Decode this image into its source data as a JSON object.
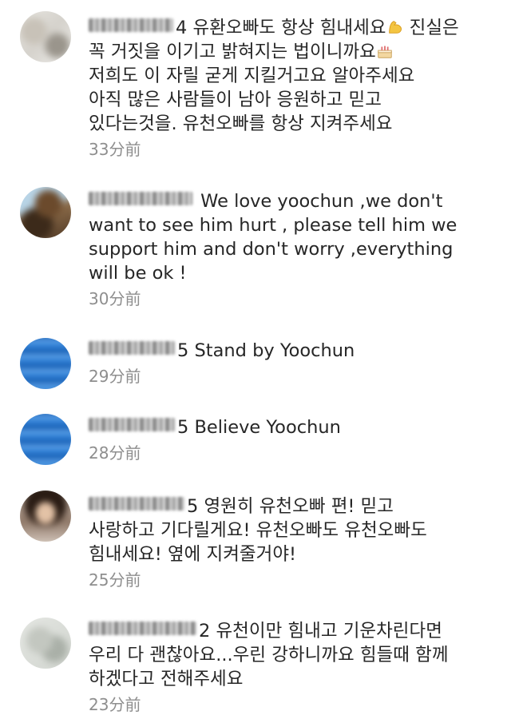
{
  "comments": [
    {
      "user_tail": "4",
      "lines": [
        "유환오빠도 항상 힘내세요",
        "진실은",
        "꼭 거짓을 이기고 밝혀지는 법이니까요",
        "저희도 이 자릴 굳게 지킬거고요 알아주세요",
        "아직 많은 사람들이 남아 응원하고 믿고",
        "있다는것을. 유천오빠를 항상 지켜주세요"
      ],
      "emoji_1": "flexed-biceps-icon",
      "emoji_2": "cake-icon",
      "time": "33分前"
    },
    {
      "user_tail": "",
      "lines": [
        "We love yoochun ,we don't",
        "want to see him hurt , please tell him we",
        "support him and don't worry ,everything",
        "will be ok !"
      ],
      "time": "30分前"
    },
    {
      "user_tail": "5",
      "lines": [
        "Stand by Yoochun"
      ],
      "time": "29分前"
    },
    {
      "user_tail": "5",
      "lines": [
        "Believe Yoochun"
      ],
      "time": "28分前"
    },
    {
      "user_tail": "5",
      "lines": [
        "영원히 유천오빠 편! 믿고",
        "사랑하고 기다릴게요! 유천오빠도 유천오빠도",
        "힘내세요! 옆에 지켜줄거야!"
      ],
      "time": "25分前"
    },
    {
      "user_tail": "2",
      "lines": [
        "유천이만 힘내고 기운차린다면",
        "우리 다 괜찮아요...우린 강하니까요 힘들때 함께",
        "하겠다고 전해주세요"
      ],
      "time": "23分前"
    }
  ]
}
